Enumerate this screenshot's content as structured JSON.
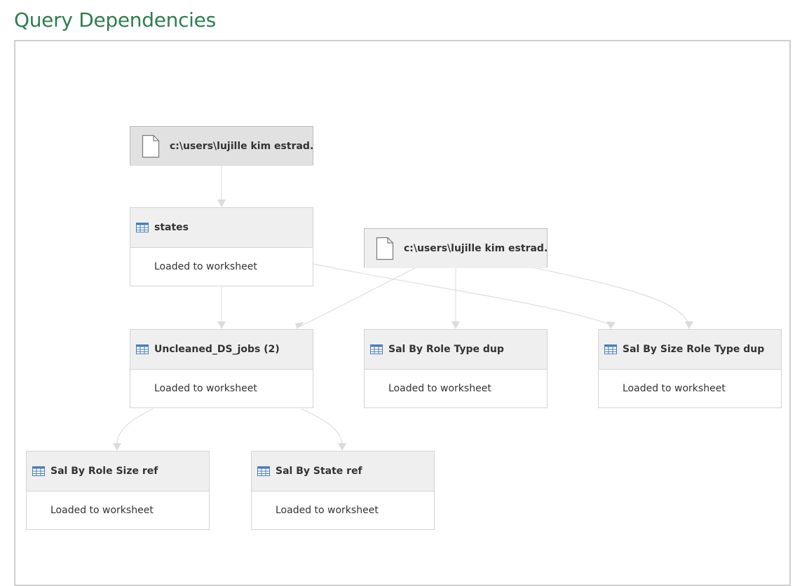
{
  "page": {
    "title": "Query Dependencies"
  },
  "nodes": {
    "source_1": {
      "label": "c:\\users\\lujille kim estrad..."
    },
    "source_2": {
      "label": "c:\\users\\lujille kim estrad..."
    },
    "states": {
      "label": "states",
      "status": "Loaded to worksheet"
    },
    "uncleaned": {
      "label": "Uncleaned_DS_jobs (2)",
      "status": "Loaded to worksheet"
    },
    "sal_role_type": {
      "label": "Sal By Role Type dup",
      "status": "Loaded to worksheet"
    },
    "sal_size_role_type": {
      "label": "Sal By Size Role Type dup",
      "status": "Loaded to worksheet"
    },
    "sal_role_size": {
      "label": "Sal By Role Size ref",
      "status": "Loaded to worksheet"
    },
    "sal_state": {
      "label": "Sal By State ref",
      "status": "Loaded to worksheet"
    }
  },
  "icons": {
    "source": "file-icon",
    "query": "table-icon"
  },
  "colors": {
    "title": "#2e7d4f",
    "table_icon": "#4a7ebb",
    "edge": "#d9d9d9"
  }
}
